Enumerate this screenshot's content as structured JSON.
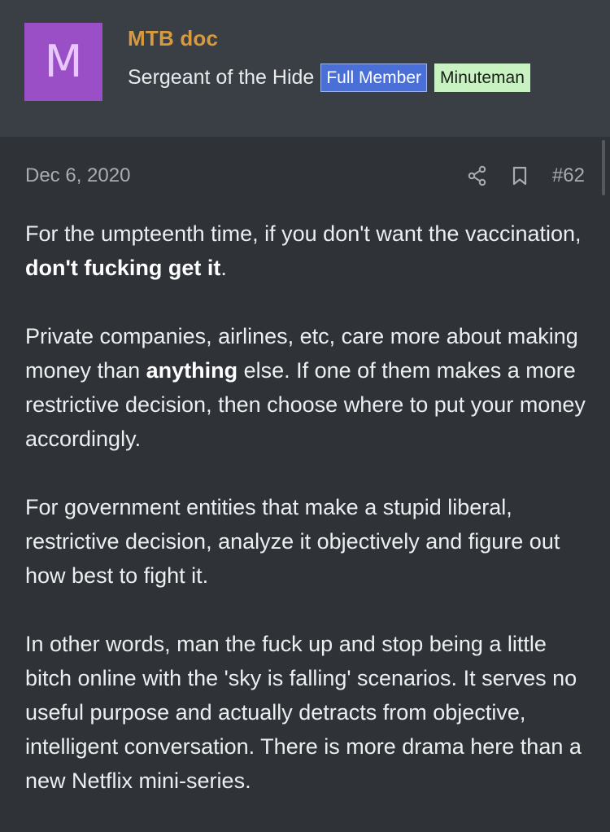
{
  "user": {
    "avatar_letter": "M",
    "avatar_color": "#9b4fc6",
    "name": "MTB doc",
    "name_color": "#d99a3c",
    "title": "Sergeant of the Hide",
    "badges": [
      {
        "label": "Full Member",
        "color": "#4a6fd6"
      },
      {
        "label": "Minuteman",
        "color": "#c9f2c2"
      }
    ]
  },
  "post": {
    "date": "Dec 6, 2020",
    "number": "#62",
    "share_icon": "share-icon",
    "bookmark_icon": "bookmark-icon",
    "paragraphs": [
      {
        "p1_a": "For the umpteenth time, if you don't want the vaccination, ",
        "p1_b": "don't fucking get it",
        "p1_c": "."
      },
      {
        "p2_a": "Private companies, airlines, etc, care more about making money than ",
        "p2_b": "anything",
        "p2_c": " else. If one of them makes a more restrictive decision, then choose where to put your money accordingly."
      },
      {
        "p3": "For government entities that make a stupid liberal, restrictive decision, analyze it objectively and figure out how best to fight it."
      },
      {
        "p4": "In other words, man the fuck up and stop being a little bitch online with the 'sky is falling' scenarios. It serves no useful purpose and actually detracts from objective, intelligent conversation. There is more drama here than a new Netflix mini-series."
      }
    ]
  }
}
